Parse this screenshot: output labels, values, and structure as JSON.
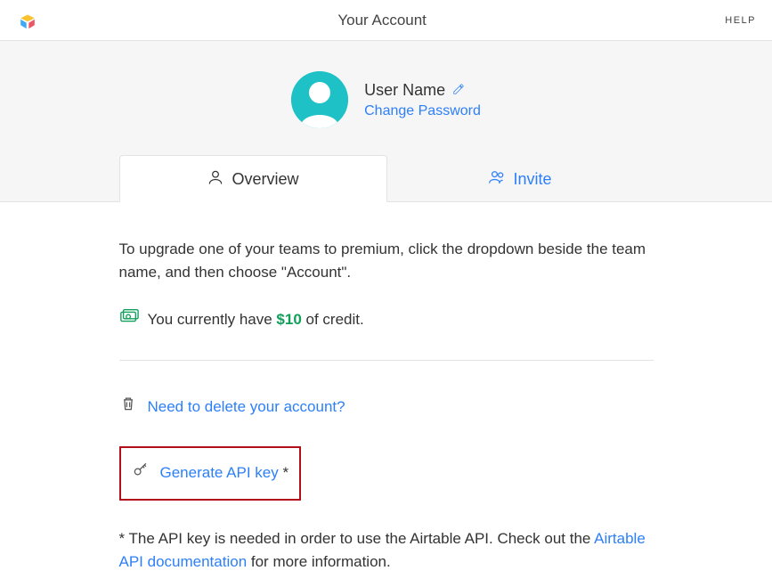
{
  "header": {
    "title": "Your Account",
    "help": "HELP"
  },
  "profile": {
    "user_name": "User Name",
    "change_password": "Change Password"
  },
  "tabs": {
    "overview": "Overview",
    "invite": "Invite"
  },
  "content": {
    "upgrade_text": "To upgrade one of your teams to premium, click the dropdown beside the team name, and then choose \"Account\".",
    "credit_prefix": "You currently have ",
    "credit_amount": "$10",
    "credit_suffix": " of credit.",
    "delete_account": "Need to delete your account?",
    "generate_api_key": "Generate API key",
    "asterisk": " *",
    "footnote_prefix": "* The API key is needed in order to use the Airtable API. Check out the ",
    "footnote_link": "Airtable API documentation",
    "footnote_suffix": " for more information."
  }
}
